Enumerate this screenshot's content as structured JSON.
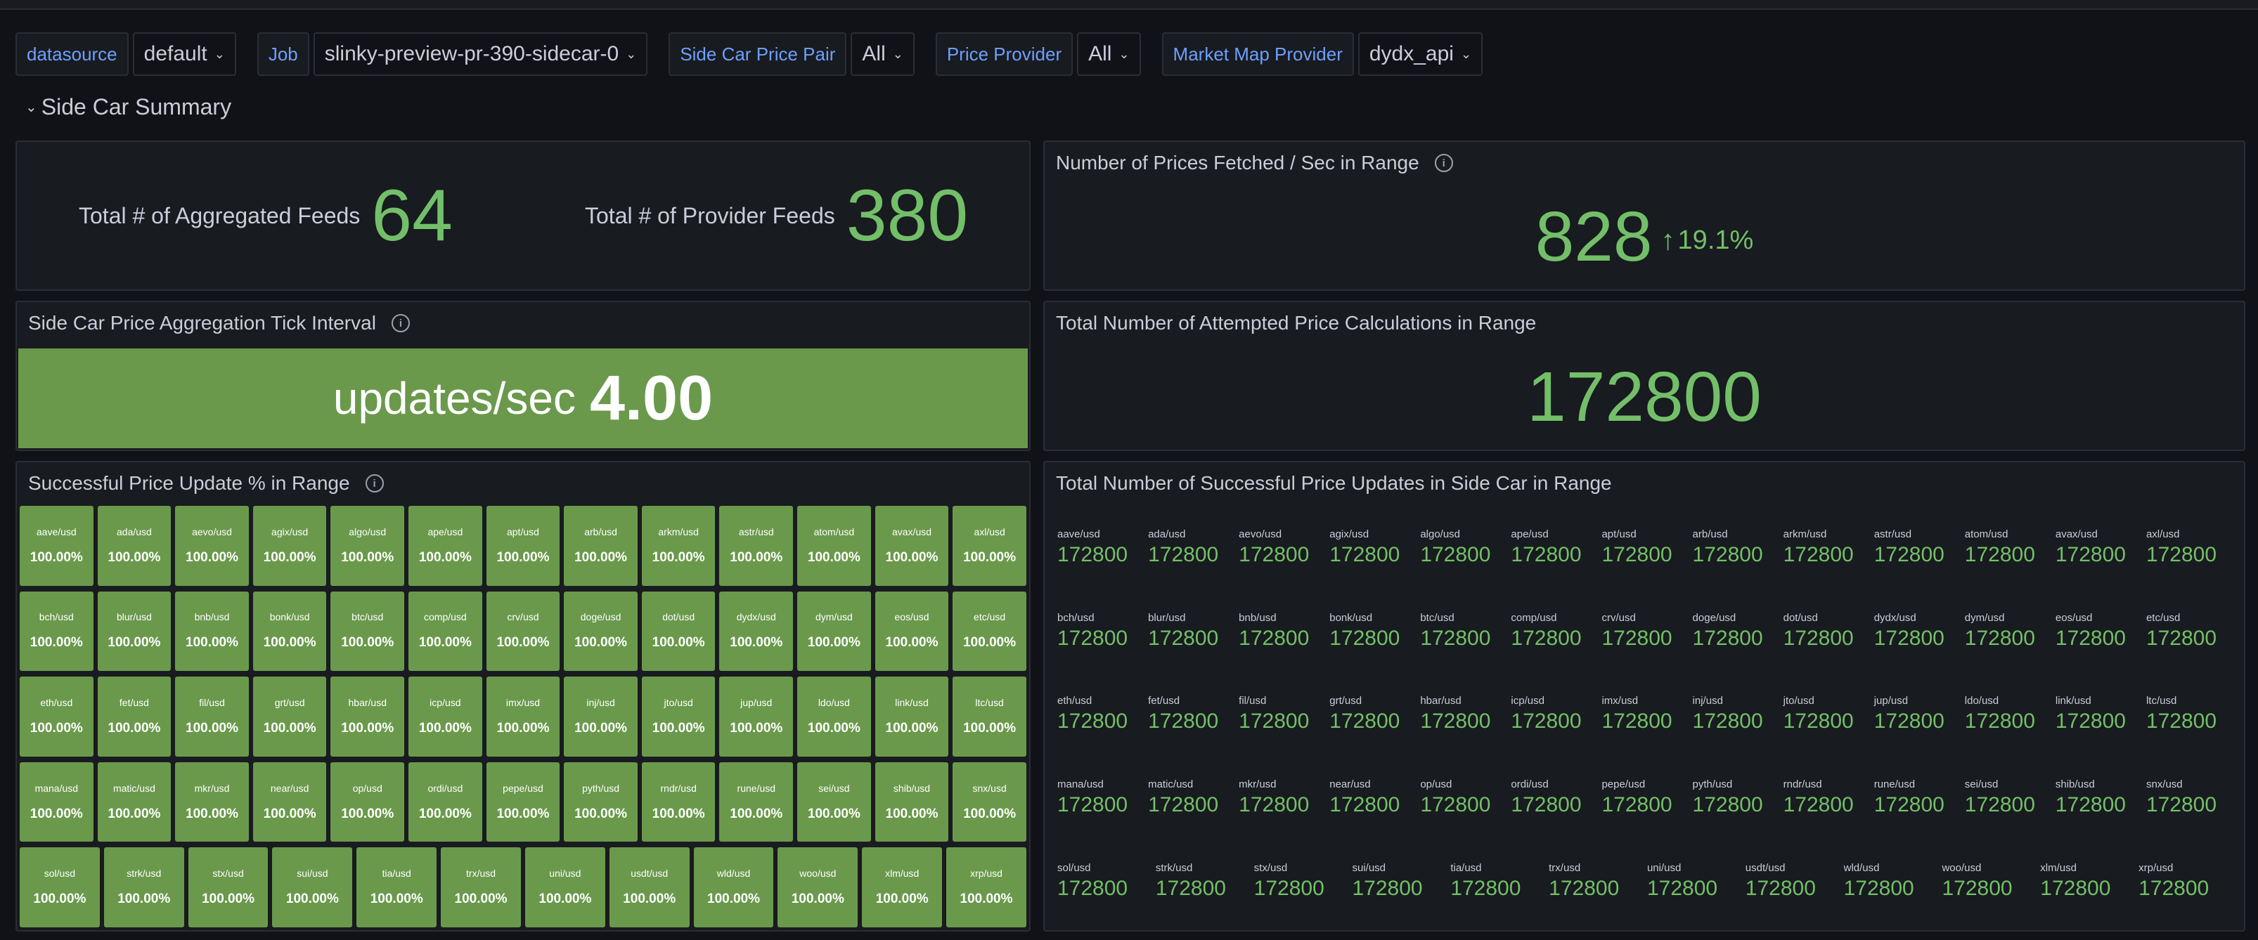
{
  "filters": [
    {
      "label": "datasource",
      "value": "default"
    },
    {
      "label": "Job",
      "value": "slinky-preview-pr-390-sidecar-0"
    },
    {
      "label": "Side Car Price Pair",
      "value": "All"
    },
    {
      "label": "Price Provider",
      "value": "All"
    },
    {
      "label": "Market Map Provider",
      "value": "dydx_api"
    }
  ],
  "row_title": "Side Car Summary",
  "feeds": {
    "aggregated_label": "Total # of Aggregated Feeds",
    "aggregated_value": "64",
    "provider_label": "Total # of Provider Feeds",
    "provider_value": "380"
  },
  "prices_fetched": {
    "title": "Number of Prices Fetched / Sec in Range",
    "value": "828",
    "delta": "19.1%",
    "delta_direction": "up"
  },
  "tick_interval": {
    "title": "Side Car Price Aggregation Tick Interval",
    "unit": "updates/sec",
    "value": "4.00"
  },
  "attempted": {
    "title": "Total Number of Attempted Price Calculations in Range",
    "value": "172800"
  },
  "success_pct": {
    "title": "Successful Price Update % in Range",
    "value": "100.00%"
  },
  "success_count": {
    "title": "Total Number of Successful Price Updates in Side Car in Range",
    "value": "172800"
  },
  "pair_rows": [
    [
      "aave/usd",
      "ada/usd",
      "aevo/usd",
      "agix/usd",
      "algo/usd",
      "ape/usd",
      "apt/usd",
      "arb/usd",
      "arkm/usd",
      "astr/usd",
      "atom/usd",
      "avax/usd",
      "axl/usd"
    ],
    [
      "bch/usd",
      "blur/usd",
      "bnb/usd",
      "bonk/usd",
      "btc/usd",
      "comp/usd",
      "crv/usd",
      "doge/usd",
      "dot/usd",
      "dydx/usd",
      "dym/usd",
      "eos/usd",
      "etc/usd"
    ],
    [
      "eth/usd",
      "fet/usd",
      "fil/usd",
      "grt/usd",
      "hbar/usd",
      "icp/usd",
      "imx/usd",
      "inj/usd",
      "jto/usd",
      "jup/usd",
      "ldo/usd",
      "link/usd",
      "ltc/usd"
    ],
    [
      "mana/usd",
      "matic/usd",
      "mkr/usd",
      "near/usd",
      "op/usd",
      "ordi/usd",
      "pepe/usd",
      "pyth/usd",
      "rndr/usd",
      "rune/usd",
      "sei/usd",
      "shib/usd",
      "snx/usd"
    ],
    [
      "sol/usd",
      "strk/usd",
      "stx/usd",
      "sui/usd",
      "tia/usd",
      "trx/usd",
      "uni/usd",
      "usdt/usd",
      "wld/usd",
      "woo/usd",
      "xlm/usd",
      "xrp/usd"
    ]
  ],
  "colors": {
    "value_green": "#73bf69",
    "tile_green": "#6a994b",
    "label_blue": "#6e9fff",
    "panel_bg": "#181b1f",
    "page_bg": "#111217"
  },
  "icons": {
    "info": "info-circle-icon",
    "chevron": "chevron-down-icon",
    "arrow": "arrow-up-icon"
  }
}
